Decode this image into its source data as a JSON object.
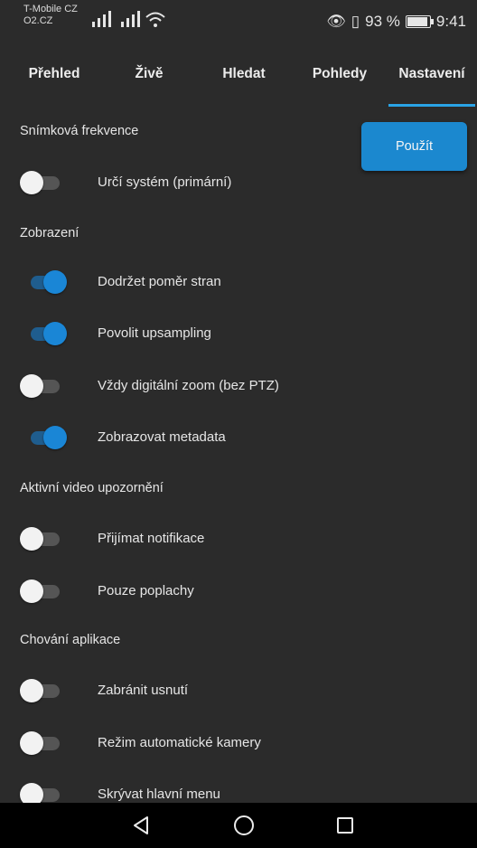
{
  "status": {
    "carrier_1": "T-Mobile CZ",
    "carrier_2": "O2.CZ",
    "battery": "93 %",
    "time": "9:41"
  },
  "tabs": [
    {
      "label": "Přehled"
    },
    {
      "label": "Živě"
    },
    {
      "label": "Hledat"
    },
    {
      "label": "Pohledy"
    },
    {
      "label": "Nastavení",
      "active": true
    }
  ],
  "apply_label": "Použít",
  "sections": {
    "frame_rate": "Snímková frekvence",
    "display": "Zobrazení",
    "alerts": "Aktivní video upozornění",
    "behavior": "Chování aplikace"
  },
  "settings": {
    "system": {
      "label": "Určí systém (primární)",
      "on": false
    },
    "aspect": {
      "label": "Dodržet poměr stran",
      "on": true
    },
    "upsampling": {
      "label": "Povolit upsampling",
      "on": true
    },
    "digital_zoom": {
      "label": "Vždy digitální zoom (bez PTZ)",
      "on": false
    },
    "metadata": {
      "label": "Zobrazovat metadata",
      "on": true
    },
    "notifications": {
      "label": "Přijímat notifikace",
      "on": false
    },
    "alarms_only": {
      "label": "Pouze poplachy",
      "on": false
    },
    "prevent_sleep": {
      "label": "Zabránit usnutí",
      "on": false
    },
    "auto_camera": {
      "label": "Režim automatické kamery",
      "on": false
    },
    "hide_menu": {
      "label": "Skrývat hlavní menu",
      "on": false
    }
  },
  "icons": {
    "back": "back-triangle-icon",
    "home": "home-circle-icon",
    "recents": "recents-square-icon",
    "accent": "#1a86d6"
  }
}
